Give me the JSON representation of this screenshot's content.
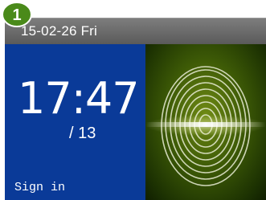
{
  "status_bar": {
    "date_text": "15-02-26  Fri"
  },
  "main": {
    "clock": "17:47",
    "sub_number": "/ 13",
    "sign_in": "Sign in"
  },
  "badge": {
    "number": "1"
  },
  "icons": {
    "fingerprint": "fingerprint-icon",
    "badge": "step-number-badge"
  },
  "colors": {
    "left_panel": "#0a3a98",
    "status_bar": "#6a6a6a",
    "badge": "#4a8a1a",
    "fingerprint_glow": "#e8f0a0"
  }
}
